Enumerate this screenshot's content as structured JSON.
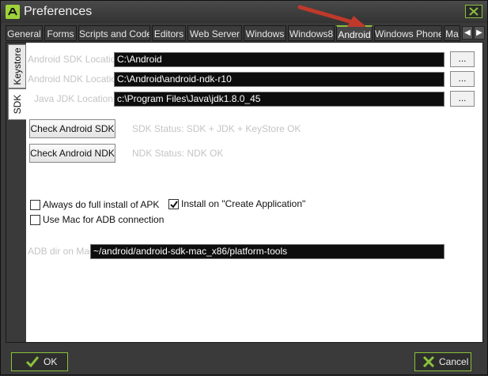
{
  "window": {
    "title": "Preferences"
  },
  "tabs": [
    {
      "label": "General"
    },
    {
      "label": "Forms"
    },
    {
      "label": "Scripts and Code"
    },
    {
      "label": "Editors"
    },
    {
      "label": "Web Server"
    },
    {
      "label": "Windows"
    },
    {
      "label": "Windows8"
    },
    {
      "label": "Android",
      "active": true
    },
    {
      "label": "Windows Phone"
    },
    {
      "label": "Ma"
    }
  ],
  "side_tabs": [
    {
      "label": "Keystore"
    },
    {
      "label": "SDK",
      "active": true
    }
  ],
  "sdk": {
    "android_sdk_label": "Android SDK Location",
    "android_sdk_value": "C:\\Android",
    "android_ndk_label": "Android NDK Location",
    "android_ndk_value": "C:\\Android\\android-ndk-r10",
    "java_jdk_label": "Java JDK Location",
    "java_jdk_value": "c:\\Program Files\\Java\\jdk1.8.0_45",
    "browse_label": "...",
    "check_sdk_label": "Check Android SDK",
    "sdk_status": "SDK Status: SDK + JDK + KeyStore OK",
    "check_ndk_label": "Check Android NDK",
    "ndk_status": "NDK Status: NDK OK",
    "full_install_label": "Always do full install of APK",
    "full_install_checked": false,
    "install_on_create_label": "Install on \"Create Application\"",
    "install_on_create_checked": true,
    "use_mac_label": "Use Mac for ADB connection",
    "use_mac_checked": false,
    "adb_dir_label": "ADB dir on Mac",
    "adb_dir_value": "~/android/android-sdk-mac_x86/platform-tools"
  },
  "footer": {
    "ok_label": "OK",
    "cancel_label": "Cancel"
  },
  "colors": {
    "accent": "#8bc13b",
    "annotation_arrow": "#c0392b"
  }
}
